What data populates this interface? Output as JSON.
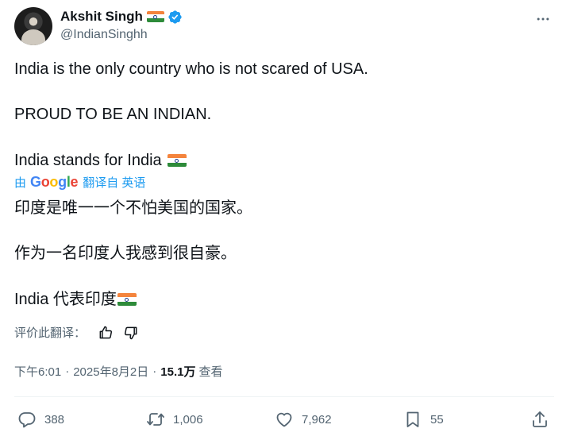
{
  "author": {
    "name": "Akshit Singh",
    "handle": "@IndianSinghh",
    "flag_icon": "india-flag-icon",
    "verified_icon": "verified-badge-icon"
  },
  "tweet": {
    "line1": "India is the only country who is not scared of USA.",
    "line2": "PROUD TO BE AN INDIAN.",
    "line3": "India stands for India"
  },
  "translation": {
    "by_label": "由",
    "provider": "Google",
    "from_label": "翻译自 英语",
    "line1": "印度是唯一一个不怕美国的国家。",
    "line2": "作为一名印度人我感到很自豪。",
    "line3": "India 代表印度"
  },
  "rate": {
    "label": "评价此翻译："
  },
  "meta": {
    "time": "下午6:01",
    "date": "2025年8月2日",
    "separator": "·",
    "views_count": "15.1万",
    "views_label": "查看"
  },
  "actions": {
    "replies": "388",
    "reposts": "1,006",
    "likes": "7,962",
    "bookmarks": "55"
  },
  "colors": {
    "accent": "#1d9bf0",
    "secondary_text": "#536471",
    "primary_text": "#0f1419"
  }
}
